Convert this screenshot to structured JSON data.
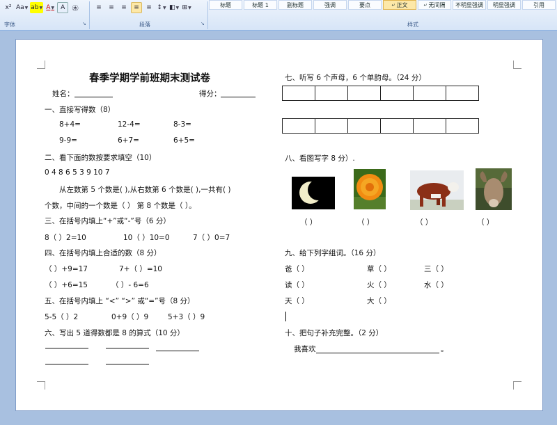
{
  "ribbon": {
    "font_tools": [
      "x²",
      "Aa",
      "ab",
      "A",
      "A",
      "㊍"
    ],
    "para_tools": [
      "≡",
      "≡",
      "≡",
      "≡",
      "≡",
      "↕",
      "◧",
      "⊞"
    ],
    "font_group": "字体",
    "para_group": "段落",
    "styles_group": "样式",
    "styles": [
      "标题",
      "标题 1",
      "副标题",
      "强调",
      "要点",
      "正文",
      "无间隔",
      "不明显强调",
      "明显强调",
      "引用"
    ],
    "active_style": "正文"
  },
  "doc": {
    "title": "春季学期学前班期末测试卷",
    "name_label": "姓名：",
    "score_label": "得分：",
    "s1": "一、直接写得数（8）",
    "s1_items": [
      "8+4=",
      "12-4=",
      "8-3=",
      "9-9=",
      "6+7=",
      "6+5="
    ],
    "s2": "二、看下面的数按要求填空（10）",
    "s2_nums": "0    4    8    6    5    3    9    10    7",
    "s2_q1": "从左数第 5 个数是(      ),从右数第 6 个数是(       ),一共有(      )",
    "s2_q2": "个数，中间的一个数是（     ）  第 8 个数是（     ）。",
    "s3": "三、在括号内填上“+”或“-”号（6 分）",
    "s3_items": [
      "8（   ）2=10",
      "10（   ）10=0",
      "7（   ）0=7"
    ],
    "s4": "四、在括号内填上合适的数（8 分）",
    "s4_items": [
      "（   ）+9=17",
      "7+（   ）=10",
      "（   ）+6=15",
      "（   ）- 6=6"
    ],
    "s5": "五、在括号内填上 “<” “>” 或“=”号（8 分）",
    "s5_items": [
      "5-5（   ）2",
      "0+9（   ）9",
      "5+3（   ）9"
    ],
    "s6": "六、写出 5 道得数都是 8 的算式（10 分）",
    "s7": "七、听写 6 个声母，6 个单韵母。（24 分）",
    "s8": "八、看图写字 8 分）.",
    "s8_parens": [
      "（      ）",
      "（      ）",
      "（      ）",
      "（      ）"
    ],
    "s8_icons": [
      "moon-image",
      "flower-image",
      "cow-image",
      "sheep-image"
    ],
    "s9": "九、给下列字组词。（16 分）",
    "s9_items": [
      "爸（      ）",
      "草（      ）",
      "三（      ）",
      "读（      ）",
      "火（      ）",
      "水（      ）",
      "天（      ）",
      "大（      ）"
    ],
    "s10": "十、把句子补充完整。（2 分）",
    "s10_sentence": "我喜欢",
    "s10_end": "。"
  }
}
